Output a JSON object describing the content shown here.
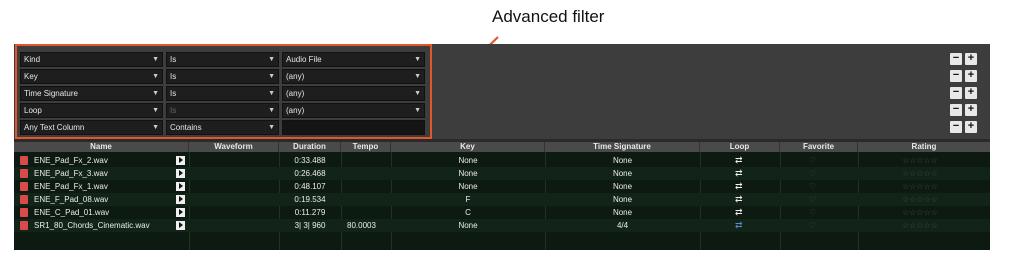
{
  "annotation": {
    "label": "Advanced filter"
  },
  "filters": [
    {
      "field": "Kind",
      "operator": "Is",
      "value": "Audio File",
      "value_has_caret": true
    },
    {
      "field": "Key",
      "operator": "Is",
      "value": "(any)",
      "value_has_caret": true
    },
    {
      "field": "Time Signature",
      "operator": "Is",
      "value": "(any)",
      "value_has_caret": true
    },
    {
      "field": "Loop",
      "operator": "Is",
      "value": "(any)",
      "value_has_caret": true,
      "operator_disabled": true
    },
    {
      "field": "Any Text Column",
      "operator": "Contains",
      "value": "",
      "is_text": true
    }
  ],
  "buttons": {
    "remove": "−",
    "add": "+"
  },
  "columns": {
    "name": "Name",
    "waveform": "Waveform",
    "duration": "Duration",
    "tempo": "Tempo",
    "key": "Key",
    "time_signature": "Time Signature",
    "loop": "Loop",
    "favorite": "Favorite",
    "rating": "Rating"
  },
  "rows": [
    {
      "name": "ENE_Pad_Fx_2.wav",
      "duration": "0:33.488",
      "tempo": "",
      "key": "None",
      "time_signature": "None",
      "loop": "white"
    },
    {
      "name": "ENE_Pad_Fx_3.wav",
      "duration": "0:26.468",
      "tempo": "",
      "key": "None",
      "time_signature": "None",
      "loop": "white"
    },
    {
      "name": "ENE_Pad_Fx_1.wav",
      "duration": "0:48.107",
      "tempo": "",
      "key": "None",
      "time_signature": "None",
      "loop": "white"
    },
    {
      "name": "ENE_F_Pad_08.wav",
      "duration": "0:19.534",
      "tempo": "",
      "key": "F",
      "time_signature": "None",
      "loop": "white"
    },
    {
      "name": "ENE_C_Pad_01.wav",
      "duration": "0:11.279",
      "tempo": "",
      "key": "C",
      "time_signature": "None",
      "loop": "white"
    },
    {
      "name": "SR1_80_Chords_Cinematic.wav",
      "duration": "3| 3| 960",
      "tempo": "80.0003",
      "key": "None",
      "time_signature": "4/4",
      "loop": "blue"
    }
  ],
  "icons": {
    "loop": "⇄",
    "heart": "♡",
    "stars": "☆☆☆☆☆",
    "caret": "▼"
  },
  "colors": {
    "highlight": "#e0572b",
    "loop_active": "#5a8ad6"
  }
}
